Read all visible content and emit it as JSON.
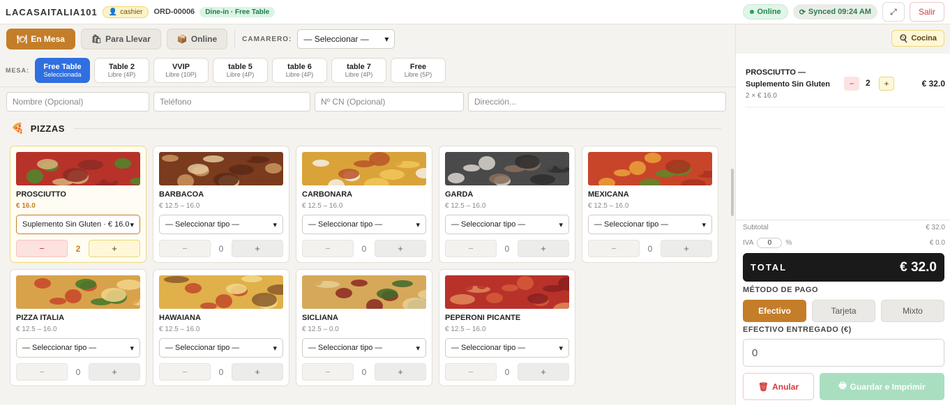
{
  "header": {
    "brand": "LACASAITALIA101",
    "role": "cashier",
    "order_id": "ORD-00006",
    "mode_badge": "Dine-in · Free Table",
    "status_online": "Online",
    "status_synced": "Synced 09:24 AM",
    "logout": "Salir"
  },
  "modes": [
    {
      "label": "En Mesa",
      "icon": "table-icon",
      "active": true
    },
    {
      "label": "Para Llevar",
      "icon": "bag-icon",
      "active": false
    },
    {
      "label": "Online",
      "icon": "box-icon",
      "active": false
    }
  ],
  "waiter": {
    "label": "CAMARERO:",
    "value": "— Seleccionar —"
  },
  "kitchen_button": "Cocina",
  "mesa_label": "MESA:",
  "tables": [
    {
      "name": "Free Table",
      "sub": "Seleccionada",
      "active": true
    },
    {
      "name": "Table 2",
      "sub": "Libre (4P)"
    },
    {
      "name": "VVIP",
      "sub": "Libre (10P)"
    },
    {
      "name": "table 5",
      "sub": "Libre (4P)"
    },
    {
      "name": "table 6",
      "sub": "Libre (4P)"
    },
    {
      "name": "table 7",
      "sub": "Libre (4P)"
    },
    {
      "name": "Free",
      "sub": "Libre (5P)"
    }
  ],
  "customer": {
    "name_placeholder": "Nombre (Opcional)",
    "phone_placeholder": "Teléfono",
    "cn_placeholder": "Nº CN (Opcional)",
    "address_placeholder": "Dirección..."
  },
  "section": {
    "title": "PIZZAS",
    "icon": "pizza-icon"
  },
  "products": [
    {
      "name": "PROSCIUTTO",
      "price": "€ 16.0",
      "select": "Suplemento Sin Gluten · € 16.0",
      "qty": "2",
      "active": true,
      "palette": [
        "#b7332a",
        "#4c8a2b",
        "#d7b27a",
        "#8c2b24"
      ]
    },
    {
      "name": "BARBACOA",
      "price": "€ 12.5 – 16.0",
      "select": "— Seleccionar tipo —",
      "qty": "0",
      "palette": [
        "#7a3b1e",
        "#c9975f",
        "#e3c79a",
        "#5c2a16"
      ]
    },
    {
      "name": "CARBONARA",
      "price": "€ 12.5 – 16.0",
      "select": "— Seleccionar tipo —",
      "qty": "0",
      "palette": [
        "#d9a33a",
        "#f4f0e6",
        "#b8552a",
        "#f0c75a"
      ]
    },
    {
      "name": "GARDA",
      "price": "€ 12.5 – 16.0",
      "select": "— Seleccionar tipo —",
      "qty": "0",
      "palette": [
        "#4a4a4a",
        "#d8d5cf",
        "#8a6d5a",
        "#2e2e2e"
      ]
    },
    {
      "name": "MEXICANA",
      "price": "€ 12.5 – 16.0",
      "select": "— Seleccionar tipo —",
      "qty": "0",
      "palette": [
        "#c8452a",
        "#e9a23a",
        "#5c8a2b",
        "#a83220"
      ]
    },
    {
      "name": "PIZZA ITALIA",
      "price": "€ 12.5 – 16.0",
      "select": "— Seleccionar tipo —",
      "qty": "0",
      "palette": [
        "#d8a24a",
        "#c8452a",
        "#3f7a2a",
        "#f2d38a"
      ]
    },
    {
      "name": "HAWAIANA",
      "price": "€ 12.5 – 16.0",
      "select": "— Seleccionar tipo —",
      "qty": "0",
      "palette": [
        "#e0b04a",
        "#c24a2a",
        "#f2d98a",
        "#8a5a2a"
      ]
    },
    {
      "name": "SICLIANA",
      "price": "€ 12.5 – 0.0",
      "select": "— Seleccionar tipo —",
      "qty": "0",
      "palette": [
        "#d6a85a",
        "#8a2a22",
        "#3f6a2a",
        "#e8cf98"
      ]
    },
    {
      "name": "PEPERONI PICANTE",
      "price": "€ 12.5 – 16.0",
      "select": "— Seleccionar tipo —",
      "qty": "0",
      "palette": [
        "#b8322a",
        "#d65a3a",
        "#8a2020",
        "#e08a5a"
      ]
    }
  ],
  "order": {
    "items": [
      {
        "name": "PROSCIUTTO —",
        "variant": "Suplemento Sin Gluten",
        "detail": "2 × € 16.0",
        "qty": "2",
        "total": "€ 32.0"
      }
    ],
    "subtotal_label": "Subtotal",
    "subtotal": "€ 32.0",
    "iva_label": "IVA",
    "iva_value": "0",
    "iva_unit": "%",
    "iva_amount": "€ 0.0",
    "total_label": "TOTAL",
    "total": "€ 32.0",
    "payment_label": "MÉTODO DE PAGO",
    "payment_methods": [
      "Efectivo",
      "Tarjeta",
      "Mixto"
    ],
    "cash_label": "EFECTIVO ENTREGADO (€)",
    "cash_value": "0",
    "cancel": "Anular",
    "save": "Guardar e Imprimir"
  },
  "colors": {
    "accent": "#c47e2a",
    "table_active": "#2f6fe0",
    "danger": "#d23c3c",
    "save": "#a9dfc0"
  }
}
